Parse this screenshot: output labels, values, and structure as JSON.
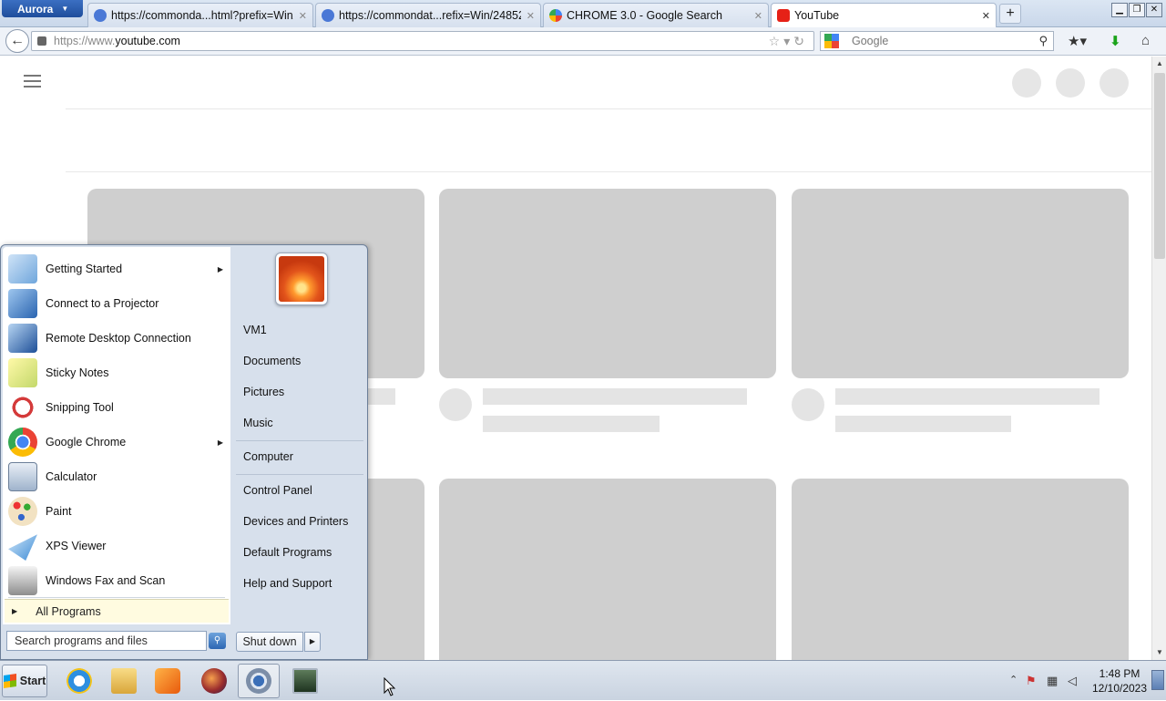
{
  "browser": {
    "app_menu_label": "Aurora",
    "tabs": [
      {
        "label": "https://commonda...html?prefix=Win/",
        "icon": "globe-icon"
      },
      {
        "label": "https://commondat...refix=Win/24852/",
        "icon": "globe-icon"
      },
      {
        "label": "CHROME 3.0 - Google Search",
        "icon": "google-icon"
      },
      {
        "label": "YouTube",
        "icon": "youtube-icon"
      }
    ],
    "new_tab_label": "+",
    "window_buttons": [
      "▁",
      "❐",
      "✕"
    ],
    "url_prefix": "https://www.",
    "url_domain": "youtube.com",
    "search_placeholder": "Google"
  },
  "start_menu": {
    "programs": [
      {
        "label": "Getting Started",
        "icon": "getting-started-icon",
        "submenu": true
      },
      {
        "label": "Connect to a Projector",
        "icon": "projector-icon",
        "submenu": false
      },
      {
        "label": "Remote Desktop Connection",
        "icon": "remote-desktop-icon",
        "submenu": false
      },
      {
        "label": "Sticky Notes",
        "icon": "sticky-notes-icon",
        "submenu": false
      },
      {
        "label": "Snipping Tool",
        "icon": "snipping-tool-icon",
        "submenu": false
      },
      {
        "label": "Google Chrome",
        "icon": "chrome-icon",
        "submenu": true
      },
      {
        "label": "Calculator",
        "icon": "calculator-icon",
        "submenu": false
      },
      {
        "label": "Paint",
        "icon": "paint-icon",
        "submenu": false
      },
      {
        "label": "XPS Viewer",
        "icon": "xps-viewer-icon",
        "submenu": false
      },
      {
        "label": "Windows Fax and Scan",
        "icon": "fax-scan-icon",
        "submenu": false
      }
    ],
    "all_programs_label": "All Programs",
    "search_placeholder": "Search programs and files",
    "user_links": [
      "VM1",
      "Documents",
      "Pictures",
      "Music"
    ],
    "computer_link": "Computer",
    "system_links": [
      "Control Panel",
      "Devices and Printers",
      "Default Programs",
      "Help and Support"
    ],
    "shutdown_label": "Shut down"
  },
  "taskbar": {
    "start_label": "Start",
    "apps": [
      "internet-explorer-icon",
      "file-explorer-icon",
      "media-player-icon",
      "firefox-aurora-icon",
      "chrome-icon",
      "network-monitor-icon"
    ],
    "time": "1:48 PM",
    "date": "12/10/2023"
  },
  "colors": {
    "skeleton_thumb": "#cfcfcf",
    "skeleton_line": "#e4e4e4",
    "all_programs_bg": "#fffbe0"
  }
}
